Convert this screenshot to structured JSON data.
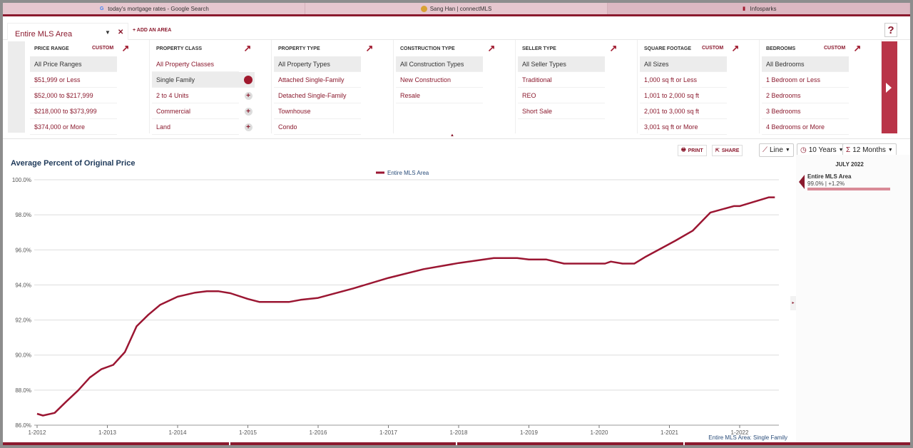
{
  "browser_tabs": [
    {
      "label": "today's mortgage rates - Google Search",
      "icon": "google-icon"
    },
    {
      "label": "Sang Han | connectMLS",
      "icon": "house-icon"
    },
    {
      "label": "Infosparks",
      "icon": "bar-chart-icon"
    }
  ],
  "area": {
    "selected": "Entire MLS Area",
    "add_label": "+ ADD AN AREA",
    "help": "?"
  },
  "filters": [
    {
      "key": "price-range",
      "header": "PRICE RANGE",
      "custom": "CUSTOM",
      "options": [
        "All Price Ranges",
        "$51,999 or Less",
        "$52,000 to $217,999",
        "$218,000 to $373,999",
        "$374,000 or More"
      ],
      "selected": 0,
      "markers": []
    },
    {
      "key": "property-class",
      "header": "PROPERTY CLASS",
      "custom": "",
      "options": [
        "All Property Classes",
        "Single Family",
        "2 to 4 Units",
        "Commercial",
        "Land"
      ],
      "selected": 1,
      "markers": [
        "",
        "dot",
        "plus",
        "plus",
        "plus"
      ]
    },
    {
      "key": "property-type",
      "header": "PROPERTY TYPE",
      "custom": "",
      "options": [
        "All Property Types",
        "Attached Single-Family",
        "Detached Single-Family",
        "Townhouse",
        "Condo"
      ],
      "selected": 0,
      "markers": []
    },
    {
      "key": "construction-type",
      "header": "CONSTRUCTION TYPE",
      "custom": "",
      "options": [
        "All Construction Types",
        "New Construction",
        "Resale"
      ],
      "selected": 0,
      "markers": []
    },
    {
      "key": "seller-type",
      "header": "SELLER TYPE",
      "custom": "",
      "options": [
        "All Seller Types",
        "Traditional",
        "REO",
        "Short Sale"
      ],
      "selected": 0,
      "markers": []
    },
    {
      "key": "square-footage",
      "header": "SQUARE FOOTAGE",
      "custom": "CUSTOM",
      "options": [
        "All Sizes",
        "1,000 sq ft or Less",
        "1,001 to 2,000 sq ft",
        "2,001 to 3,000 sq ft",
        "3,001 sq ft or More"
      ],
      "selected": 0,
      "markers": []
    },
    {
      "key": "bedrooms",
      "header": "BEDROOMS",
      "custom": "CUSTOM",
      "options": [
        "All Bedrooms",
        "1 Bedroom or Less",
        "2 Bedrooms",
        "3 Bedrooms",
        "4 Bedrooms or More"
      ],
      "selected": 0,
      "markers": []
    }
  ],
  "toolbar": {
    "print": "PRINT",
    "share": "SHARE",
    "chart_type": "Line",
    "period": "10 Years",
    "rolling": "12 Months"
  },
  "summary": {
    "date": "JULY 2022",
    "name": "Entire MLS Area",
    "value": "99.0% | +1.2%"
  },
  "footer_note": "Entire MLS Area: Single Family",
  "colors": {
    "brand": "#8b1a2e",
    "line": "#9b1632",
    "title": "#1f3a5a"
  },
  "chart_data": {
    "type": "line",
    "title": "Average Percent of Original Price",
    "legend": "top-center",
    "grid": true,
    "ylim": [
      86,
      100
    ],
    "yticks": [
      "86.0%",
      "88.0%",
      "90.0%",
      "92.0%",
      "94.0%",
      "96.0%",
      "98.0%",
      "100.0%"
    ],
    "xticks": [
      "1-2012",
      "1-2013",
      "1-2014",
      "1-2015",
      "1-2016",
      "1-2017",
      "1-2018",
      "1-2019",
      "1-2020",
      "1-2021",
      "1-2022"
    ],
    "series": [
      {
        "name": "Entire MLS Area",
        "points": [
          [
            "2012-01",
            86.65
          ],
          [
            "2012-02",
            86.55
          ],
          [
            "2012-04",
            86.7
          ],
          [
            "2012-06",
            87.35
          ],
          [
            "2012-08",
            87.98
          ],
          [
            "2012-10",
            88.72
          ],
          [
            "2012-12",
            89.2
          ],
          [
            "2013-02",
            89.44
          ],
          [
            "2013-04",
            90.17
          ],
          [
            "2013-06",
            91.64
          ],
          [
            "2013-08",
            92.3
          ],
          [
            "2013-10",
            92.86
          ],
          [
            "2014-01",
            93.33
          ],
          [
            "2014-04",
            93.56
          ],
          [
            "2014-06",
            93.64
          ],
          [
            "2014-08",
            93.64
          ],
          [
            "2014-10",
            93.53
          ],
          [
            "2015-01",
            93.2
          ],
          [
            "2015-03",
            93.03
          ],
          [
            "2015-08",
            93.03
          ],
          [
            "2015-10",
            93.15
          ],
          [
            "2016-01",
            93.26
          ],
          [
            "2016-07",
            93.8
          ],
          [
            "2017-01",
            94.4
          ],
          [
            "2017-07",
            94.9
          ],
          [
            "2018-01",
            95.25
          ],
          [
            "2018-07",
            95.53
          ],
          [
            "2018-11",
            95.53
          ],
          [
            "2019-01",
            95.45
          ],
          [
            "2019-04",
            95.45
          ],
          [
            "2019-07",
            95.22
          ],
          [
            "2020-02",
            95.22
          ],
          [
            "2020-03",
            95.33
          ],
          [
            "2020-05",
            95.22
          ],
          [
            "2020-07",
            95.22
          ],
          [
            "2020-09",
            95.62
          ],
          [
            "2020-12",
            96.16
          ],
          [
            "2021-02",
            96.52
          ],
          [
            "2021-05",
            97.1
          ],
          [
            "2021-08",
            98.13
          ],
          [
            "2021-12",
            98.5
          ],
          [
            "2022-01",
            98.5
          ],
          [
            "2022-06",
            99.0
          ],
          [
            "2022-07",
            99.0
          ]
        ]
      }
    ]
  }
}
